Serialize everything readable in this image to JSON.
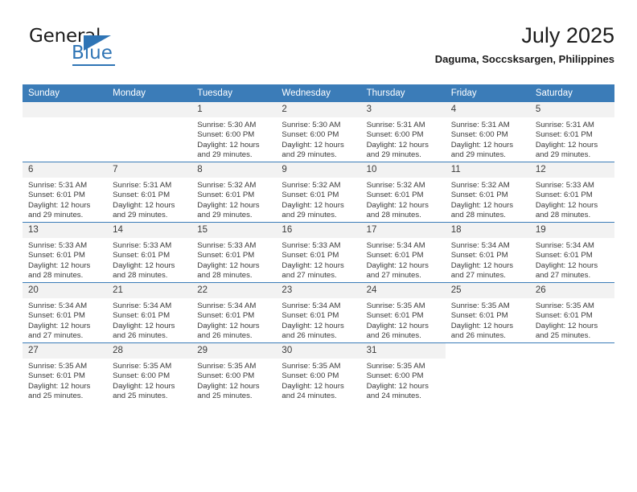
{
  "logo": {
    "text_primary": "General",
    "text_secondary": "Blue",
    "icon": "triangle-flag-icon",
    "brand_color": "#2e74b5"
  },
  "header": {
    "title": "July 2025",
    "subtitle": "Daguma, Soccsksargen, Philippines"
  },
  "theme": {
    "header_blue": "#3b7cb8",
    "daynum_band": "#f2f2f2",
    "text": "#3a3a3a"
  },
  "weekday_headers": [
    "Sunday",
    "Monday",
    "Tuesday",
    "Wednesday",
    "Thursday",
    "Friday",
    "Saturday"
  ],
  "weeks": [
    {
      "days": [
        {
          "date": "",
          "blank": true,
          "lines": []
        },
        {
          "date": "",
          "blank": true,
          "lines": []
        },
        {
          "date": "1",
          "lines": [
            "Sunrise: 5:30 AM",
            "Sunset: 6:00 PM",
            "Daylight: 12 hours",
            "and 29 minutes."
          ]
        },
        {
          "date": "2",
          "lines": [
            "Sunrise: 5:30 AM",
            "Sunset: 6:00 PM",
            "Daylight: 12 hours",
            "and 29 minutes."
          ]
        },
        {
          "date": "3",
          "lines": [
            "Sunrise: 5:31 AM",
            "Sunset: 6:00 PM",
            "Daylight: 12 hours",
            "and 29 minutes."
          ]
        },
        {
          "date": "4",
          "lines": [
            "Sunrise: 5:31 AM",
            "Sunset: 6:00 PM",
            "Daylight: 12 hours",
            "and 29 minutes."
          ]
        },
        {
          "date": "5",
          "lines": [
            "Sunrise: 5:31 AM",
            "Sunset: 6:01 PM",
            "Daylight: 12 hours",
            "and 29 minutes."
          ]
        }
      ]
    },
    {
      "days": [
        {
          "date": "6",
          "lines": [
            "Sunrise: 5:31 AM",
            "Sunset: 6:01 PM",
            "Daylight: 12 hours",
            "and 29 minutes."
          ]
        },
        {
          "date": "7",
          "lines": [
            "Sunrise: 5:31 AM",
            "Sunset: 6:01 PM",
            "Daylight: 12 hours",
            "and 29 minutes."
          ]
        },
        {
          "date": "8",
          "lines": [
            "Sunrise: 5:32 AM",
            "Sunset: 6:01 PM",
            "Daylight: 12 hours",
            "and 29 minutes."
          ]
        },
        {
          "date": "9",
          "lines": [
            "Sunrise: 5:32 AM",
            "Sunset: 6:01 PM",
            "Daylight: 12 hours",
            "and 29 minutes."
          ]
        },
        {
          "date": "10",
          "lines": [
            "Sunrise: 5:32 AM",
            "Sunset: 6:01 PM",
            "Daylight: 12 hours",
            "and 28 minutes."
          ]
        },
        {
          "date": "11",
          "lines": [
            "Sunrise: 5:32 AM",
            "Sunset: 6:01 PM",
            "Daylight: 12 hours",
            "and 28 minutes."
          ]
        },
        {
          "date": "12",
          "lines": [
            "Sunrise: 5:33 AM",
            "Sunset: 6:01 PM",
            "Daylight: 12 hours",
            "and 28 minutes."
          ]
        }
      ]
    },
    {
      "days": [
        {
          "date": "13",
          "lines": [
            "Sunrise: 5:33 AM",
            "Sunset: 6:01 PM",
            "Daylight: 12 hours",
            "and 28 minutes."
          ]
        },
        {
          "date": "14",
          "lines": [
            "Sunrise: 5:33 AM",
            "Sunset: 6:01 PM",
            "Daylight: 12 hours",
            "and 28 minutes."
          ]
        },
        {
          "date": "15",
          "lines": [
            "Sunrise: 5:33 AM",
            "Sunset: 6:01 PM",
            "Daylight: 12 hours",
            "and 28 minutes."
          ]
        },
        {
          "date": "16",
          "lines": [
            "Sunrise: 5:33 AM",
            "Sunset: 6:01 PM",
            "Daylight: 12 hours",
            "and 27 minutes."
          ]
        },
        {
          "date": "17",
          "lines": [
            "Sunrise: 5:34 AM",
            "Sunset: 6:01 PM",
            "Daylight: 12 hours",
            "and 27 minutes."
          ]
        },
        {
          "date": "18",
          "lines": [
            "Sunrise: 5:34 AM",
            "Sunset: 6:01 PM",
            "Daylight: 12 hours",
            "and 27 minutes."
          ]
        },
        {
          "date": "19",
          "lines": [
            "Sunrise: 5:34 AM",
            "Sunset: 6:01 PM",
            "Daylight: 12 hours",
            "and 27 minutes."
          ]
        }
      ]
    },
    {
      "days": [
        {
          "date": "20",
          "lines": [
            "Sunrise: 5:34 AM",
            "Sunset: 6:01 PM",
            "Daylight: 12 hours",
            "and 27 minutes."
          ]
        },
        {
          "date": "21",
          "lines": [
            "Sunrise: 5:34 AM",
            "Sunset: 6:01 PM",
            "Daylight: 12 hours",
            "and 26 minutes."
          ]
        },
        {
          "date": "22",
          "lines": [
            "Sunrise: 5:34 AM",
            "Sunset: 6:01 PM",
            "Daylight: 12 hours",
            "and 26 minutes."
          ]
        },
        {
          "date": "23",
          "lines": [
            "Sunrise: 5:34 AM",
            "Sunset: 6:01 PM",
            "Daylight: 12 hours",
            "and 26 minutes."
          ]
        },
        {
          "date": "24",
          "lines": [
            "Sunrise: 5:35 AM",
            "Sunset: 6:01 PM",
            "Daylight: 12 hours",
            "and 26 minutes."
          ]
        },
        {
          "date": "25",
          "lines": [
            "Sunrise: 5:35 AM",
            "Sunset: 6:01 PM",
            "Daylight: 12 hours",
            "and 26 minutes."
          ]
        },
        {
          "date": "26",
          "lines": [
            "Sunrise: 5:35 AM",
            "Sunset: 6:01 PM",
            "Daylight: 12 hours",
            "and 25 minutes."
          ]
        }
      ]
    },
    {
      "days": [
        {
          "date": "27",
          "lines": [
            "Sunrise: 5:35 AM",
            "Sunset: 6:01 PM",
            "Daylight: 12 hours",
            "and 25 minutes."
          ]
        },
        {
          "date": "28",
          "lines": [
            "Sunrise: 5:35 AM",
            "Sunset: 6:00 PM",
            "Daylight: 12 hours",
            "and 25 minutes."
          ]
        },
        {
          "date": "29",
          "lines": [
            "Sunrise: 5:35 AM",
            "Sunset: 6:00 PM",
            "Daylight: 12 hours",
            "and 25 minutes."
          ]
        },
        {
          "date": "30",
          "lines": [
            "Sunrise: 5:35 AM",
            "Sunset: 6:00 PM",
            "Daylight: 12 hours",
            "and 24 minutes."
          ]
        },
        {
          "date": "31",
          "lines": [
            "Sunrise: 5:35 AM",
            "Sunset: 6:00 PM",
            "Daylight: 12 hours",
            "and 24 minutes."
          ]
        },
        {
          "date": "",
          "blank": true,
          "lines": []
        },
        {
          "date": "",
          "blank": true,
          "lines": []
        }
      ]
    }
  ]
}
